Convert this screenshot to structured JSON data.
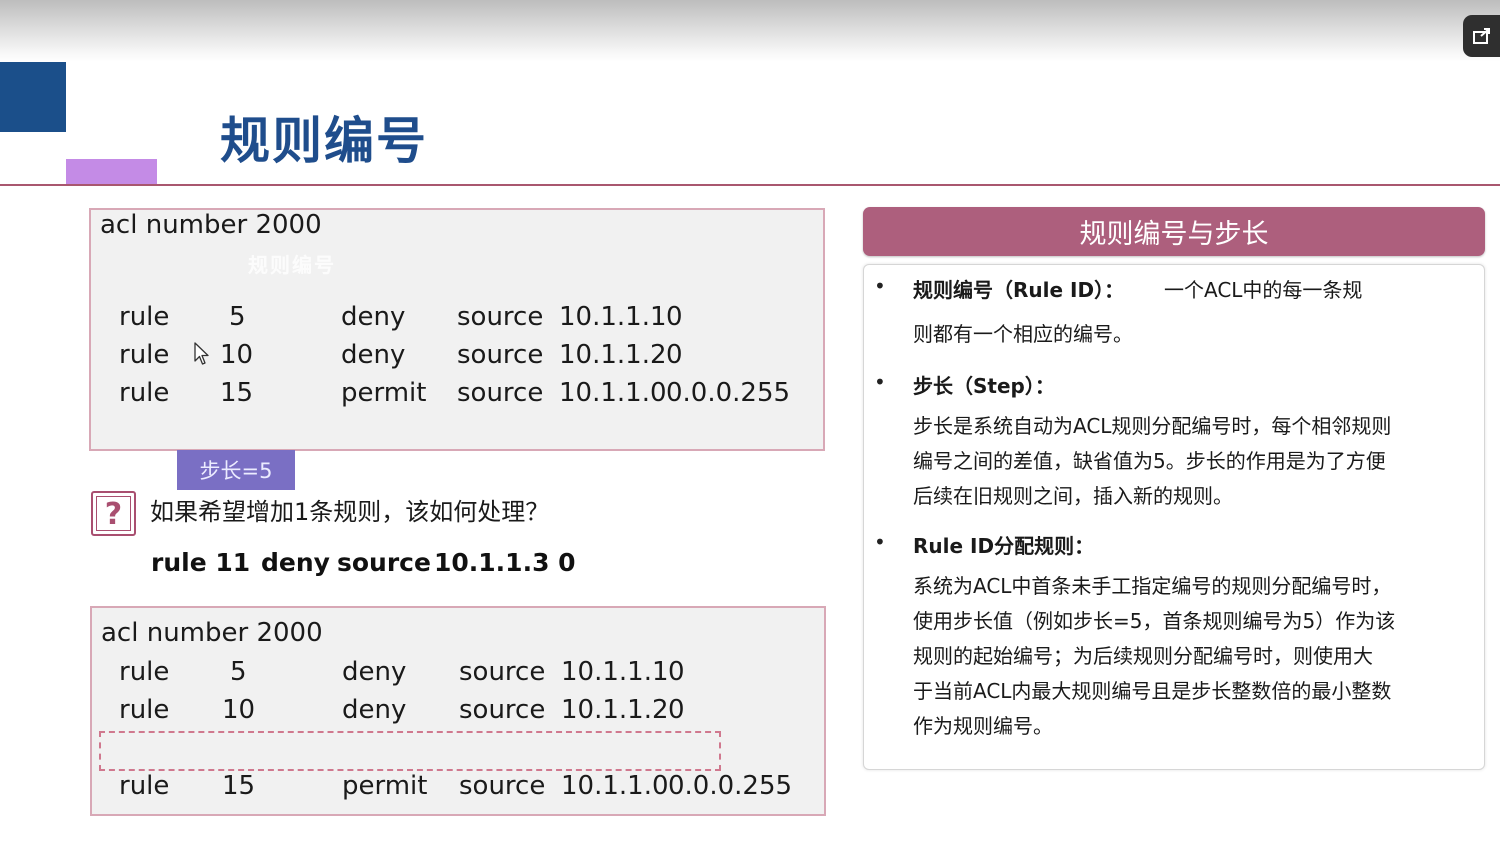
{
  "slide": {
    "title": "规则编号"
  },
  "acl_box1": {
    "header": "acl number 2000",
    "ghost_text": "规则编号",
    "rows": [
      {
        "keyword": "rule",
        "id": "5",
        "action": "deny",
        "src": "source",
        "ip": "10.1.1.1",
        "wildcard": "0"
      },
      {
        "keyword": "rule",
        "id": "10",
        "action": "deny",
        "src": "source",
        "ip": "10.1.1.2",
        "wildcard": "0"
      },
      {
        "keyword": "rule",
        "id": "15",
        "action": "permit",
        "src": "source",
        "ip": "10.1.1.0",
        "wildcard": "0.0.0.255"
      }
    ]
  },
  "step_tag": "步长=5",
  "question": "如果希望增加1条规则，该如何处理？",
  "answer": {
    "keyword": "rule 11",
    "action": "deny",
    "src": "source",
    "ip": "10.1.1.3 0"
  },
  "acl_box2": {
    "header": "acl number 2000",
    "rows": [
      {
        "keyword": "rule",
        "id": "5",
        "action": "deny",
        "src": "source",
        "ip": "10.1.1.1",
        "wildcard": "0"
      },
      {
        "keyword": "rule",
        "id": "10",
        "action": "deny",
        "src": "source",
        "ip": "10.1.1.2",
        "wildcard": "0"
      },
      {
        "keyword": "rule",
        "id": "15",
        "action": "permit",
        "src": "source",
        "ip": "10.1.1.0",
        "wildcard": "0.0.0.255"
      }
    ]
  },
  "side": {
    "header": "规则编号与步长",
    "bullet_char": "•",
    "item1": {
      "label": "规则编号（Rule ID）：",
      "line1_rest": "一个ACL中的每一条规",
      "line2": "则都有一个相应的编号。"
    },
    "item2": {
      "label": "步长（Step）：",
      "lines": [
        "步长是系统自动为ACL规则分配编号时，每个相邻规则",
        "编号之间的差值，缺省值为5。步长的作用是为了方便",
        "后续在旧规则之间，插入新的规则。"
      ]
    },
    "item3": {
      "label": "Rule ID分配规则：",
      "lines": [
        "系统为ACL中首条未手工指定编号的规则分配编号时，",
        "使用步长值（例如步长=5，首条规则编号为5）作为该",
        "规则的起始编号；为后续规则分配编号时，则使用大",
        "于当前ACL内最大规则编号且是步长整数倍的最小整数",
        "作为规则编号。"
      ]
    }
  },
  "colors": {
    "title": "#1f4d8c",
    "accent_blue": "#1b4f8a",
    "accent_purple": "#c48be6",
    "rule_line": "#a9576f",
    "side_header": "#ad5f7d",
    "step_tag": "#7a6fc4"
  },
  "icons": [
    "popout-icon",
    "cursor-icon",
    "question-icon"
  ]
}
